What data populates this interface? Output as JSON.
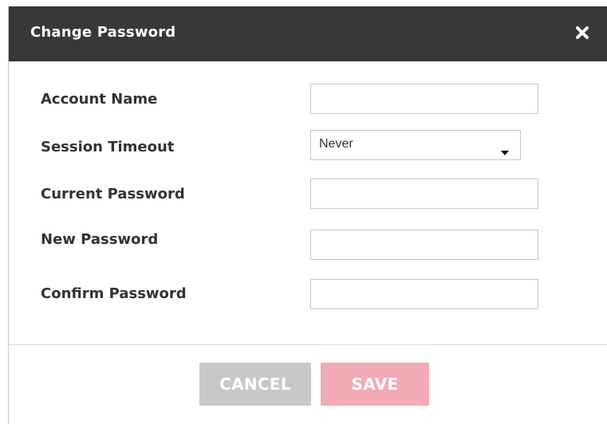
{
  "dialog": {
    "title": "Change Password",
    "close_icon": "close-icon"
  },
  "form": {
    "account_name": {
      "label": "Account Name",
      "value": "",
      "placeholder": ""
    },
    "session_timeout": {
      "label": "Session Timeout",
      "selected": "Never",
      "icon": "caret-down-icon"
    },
    "current_password": {
      "label": "Current Password",
      "value": "",
      "placeholder": ""
    },
    "new_password": {
      "label": "New Password",
      "value": "",
      "placeholder": ""
    },
    "confirm_password": {
      "label": "Confirm Password",
      "value": "",
      "placeholder": ""
    }
  },
  "actions": {
    "cancel_label": "CANCEL",
    "save_label": "SAVE"
  },
  "colors": {
    "titlebar": "#383838",
    "cancel_button": "#c8c8c8",
    "save_button_disabled": "#f2aab4"
  }
}
